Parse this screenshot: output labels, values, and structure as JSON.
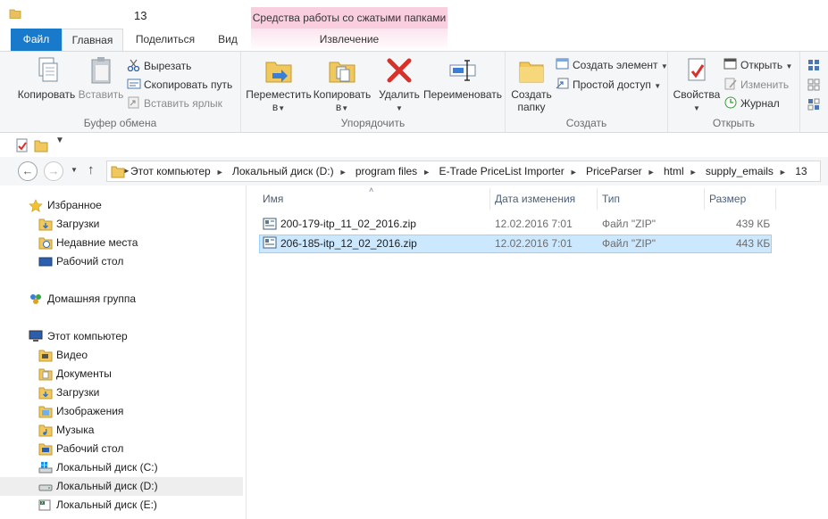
{
  "window": {
    "title": "13",
    "context_tab": "Средства работы со сжатыми папками"
  },
  "tabs": {
    "file": "Файл",
    "home": "Главная",
    "share": "Поделиться",
    "view": "Вид",
    "extract": "Извлечение"
  },
  "ribbon": {
    "clipboard": {
      "label": "Буфер обмена",
      "copy": "Копировать",
      "paste": "Вставить",
      "cut": "Вырезать",
      "copy_path": "Скопировать путь",
      "paste_shortcut": "Вставить ярлык"
    },
    "organize": {
      "label": "Упорядочить",
      "move_to_l1": "Переместить",
      "move_to_l2": "в",
      "copy_to_l1": "Копировать",
      "copy_to_l2": "в",
      "delete": "Удалить",
      "rename": "Переименовать"
    },
    "create": {
      "label": "Создать",
      "new_folder_l1": "Создать",
      "new_folder_l2": "папку",
      "new_item": "Создать элемент",
      "easy_access": "Простой доступ"
    },
    "open": {
      "label": "Открыть",
      "properties": "Свойства",
      "open": "Открыть",
      "edit": "Изменить",
      "history": "Журнал"
    }
  },
  "address": {
    "crumbs": [
      "Этот компьютер",
      "Локальный диск (D:)",
      "program files",
      "E-Trade PriceList Importer",
      "PriceParser",
      "html",
      "supply_emails",
      "13"
    ]
  },
  "nav": {
    "favorites": "Избранное",
    "downloads": "Загрузки",
    "recent": "Недавние места",
    "desktop": "Рабочий стол",
    "homegroup": "Домашняя группа",
    "this_pc": "Этот компьютер",
    "video": "Видео",
    "documents": "Документы",
    "downloads2": "Загрузки",
    "pictures": "Изображения",
    "music": "Музыка",
    "desktop2": "Рабочий стол",
    "drive_c": "Локальный диск (C:)",
    "drive_d": "Локальный диск (D:)",
    "drive_e": "Локальный диск (E:)"
  },
  "columns": {
    "name": "Имя",
    "date": "Дата изменения",
    "type": "Тип",
    "size": "Размер"
  },
  "files": [
    {
      "name": "200-179-itp_11_02_2016.zip",
      "date": "12.02.2016 7:01",
      "type": "Файл \"ZIP\"",
      "size": "439 КБ"
    },
    {
      "name": "206-185-itp_12_02_2016.zip",
      "date": "12.02.2016 7:01",
      "type": "Файл \"ZIP\"",
      "size": "443 КБ"
    }
  ],
  "colors": {
    "file_tab": "#1979ca",
    "context_tab": "#f9cfe0",
    "selection": "#cce8ff"
  }
}
